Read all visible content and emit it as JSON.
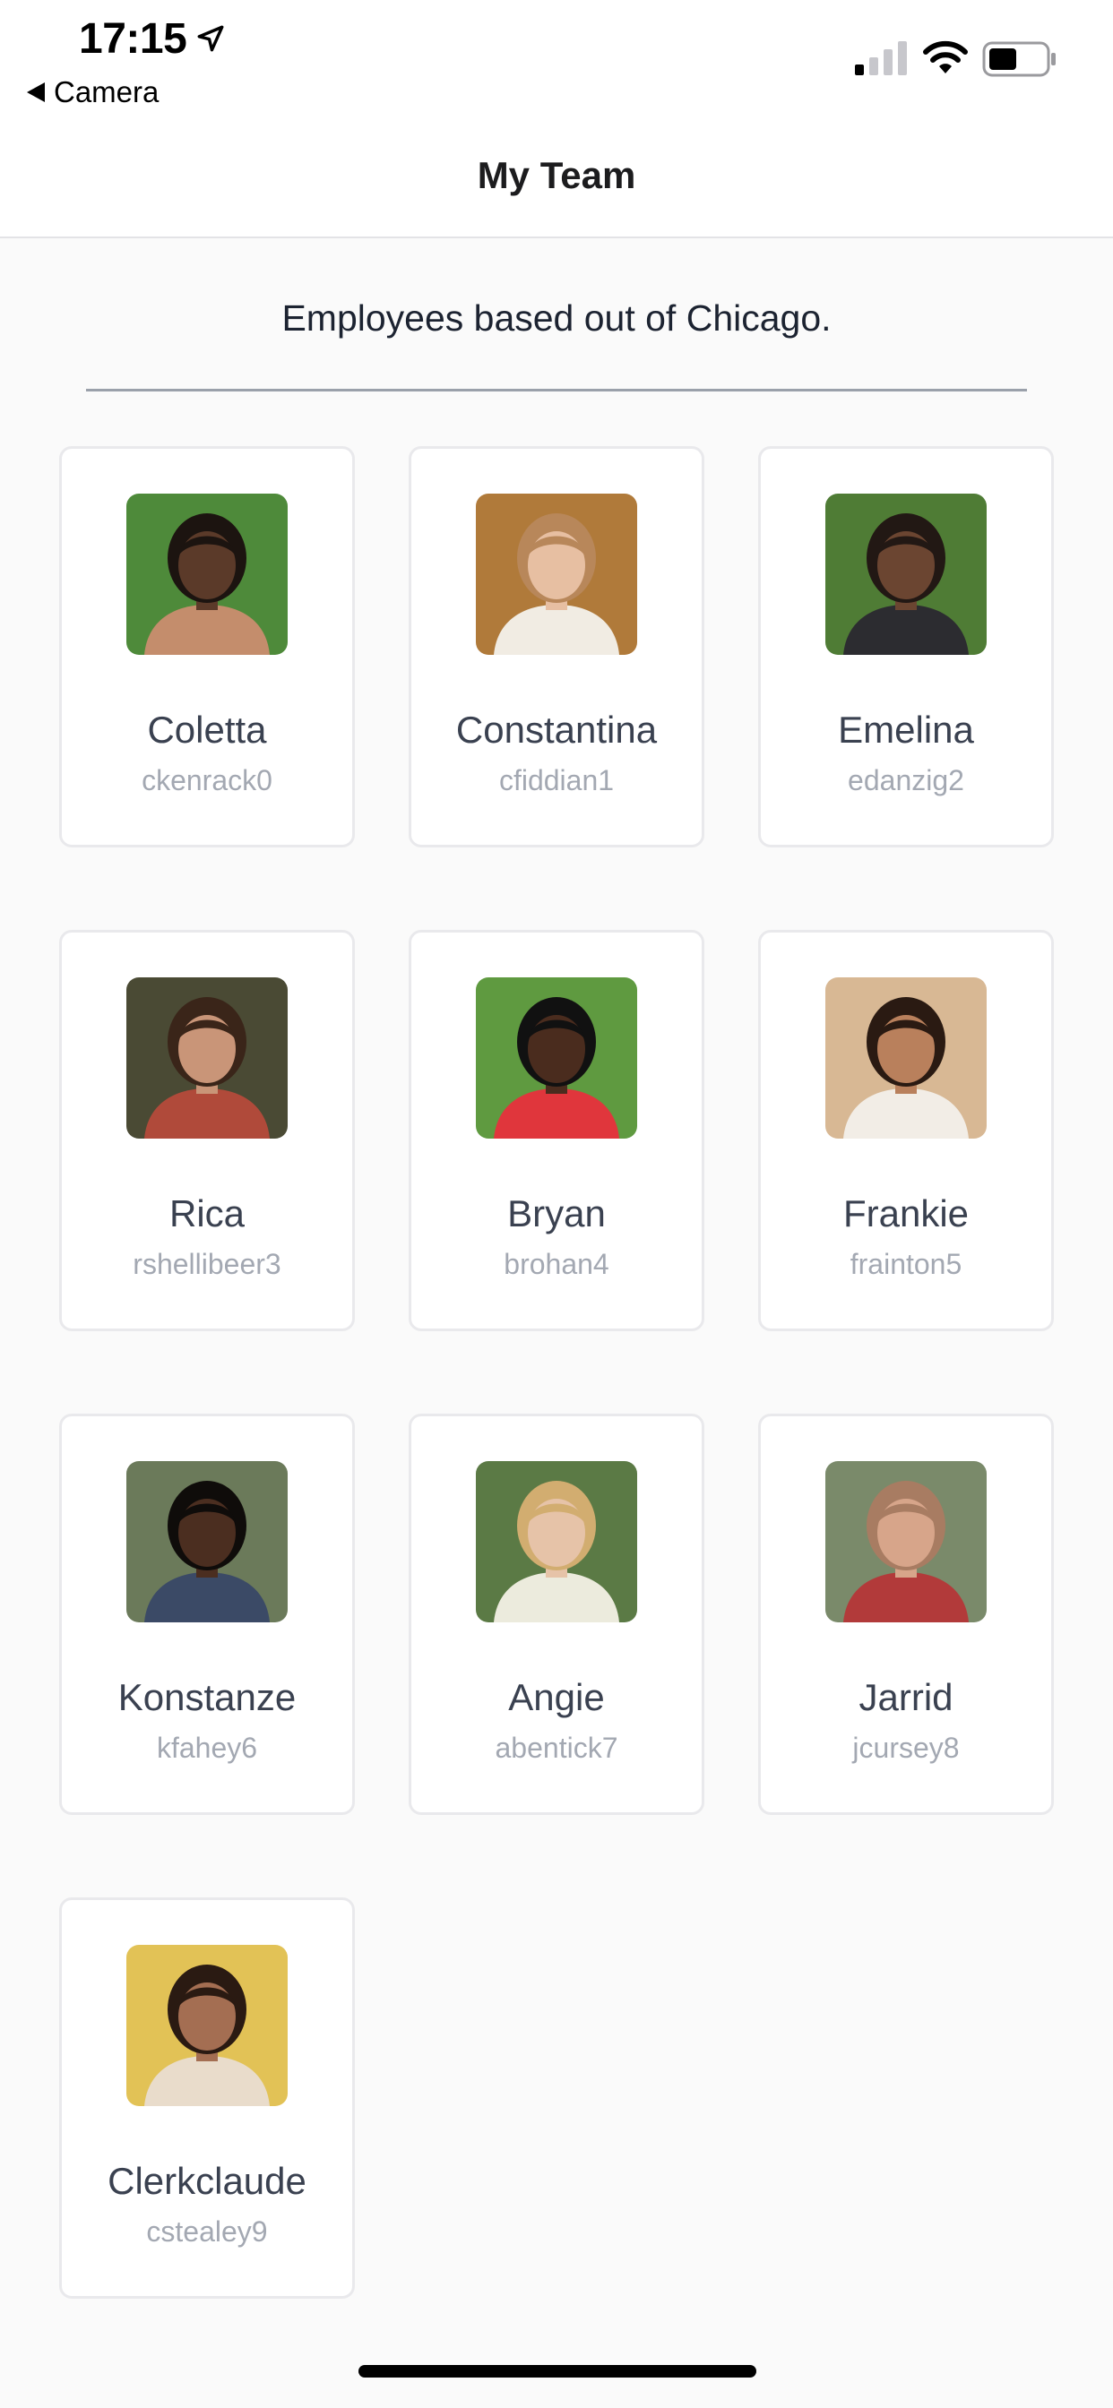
{
  "status_bar": {
    "time": "17:15",
    "back_app": "Camera"
  },
  "nav": {
    "title": "My Team"
  },
  "subtitle": "Employees based out of Chicago.",
  "employees": [
    {
      "name": "Coletta",
      "username": "ckenrack0",
      "bg": "#4e8a3a",
      "skin": "#5b3a29",
      "hair": "#1c1410",
      "shirt": "#c48d6c"
    },
    {
      "name": "Constantina",
      "username": "cfiddian1",
      "bg": "#b07a3a",
      "skin": "#e7bfa2",
      "hair": "#b8875a",
      "shirt": "#f1ece3"
    },
    {
      "name": "Emelina",
      "username": "edanzig2",
      "bg": "#4f7c35",
      "skin": "#6b4531",
      "hair": "#221814",
      "shirt": "#2c2c30"
    },
    {
      "name": "Rica",
      "username": "rshellibeer3",
      "bg": "#4a4a34",
      "skin": "#c99578",
      "hair": "#3a2519",
      "shirt": "#b04a3a"
    },
    {
      "name": "Bryan",
      "username": "brohan4",
      "bg": "#5f9a40",
      "skin": "#4a2c1e",
      "hair": "#111111",
      "shirt": "#e0363c"
    },
    {
      "name": "Frankie",
      "username": "frainton5",
      "bg": "#d8b894",
      "skin": "#b9805c",
      "hair": "#2a1a12",
      "shirt": "#f2ede6"
    },
    {
      "name": "Konstanze",
      "username": "kfahey6",
      "bg": "#6b7a5a",
      "skin": "#4b2e20",
      "hair": "#0f0c0a",
      "shirt": "#3b4a66"
    },
    {
      "name": "Angie",
      "username": "abentick7",
      "bg": "#5b7a45",
      "skin": "#e6c3a8",
      "hair": "#d2ad70",
      "shirt": "#ecebdd"
    },
    {
      "name": "Jarrid",
      "username": "jcursey8",
      "bg": "#7a8a6a",
      "skin": "#d7a58a",
      "hair": "#a87c62",
      "shirt": "#b23a3a"
    },
    {
      "name": "Clerkclaude",
      "username": "cstealey9",
      "bg": "#e2c256",
      "skin": "#a46e52",
      "hair": "#2a1a12",
      "shirt": "#e9dccb"
    }
  ],
  "colors": {
    "card_border": "#e9e9ec",
    "name_text": "#3a4150",
    "username_text": "#a3a8b2",
    "page_bg": "#fafafa"
  }
}
